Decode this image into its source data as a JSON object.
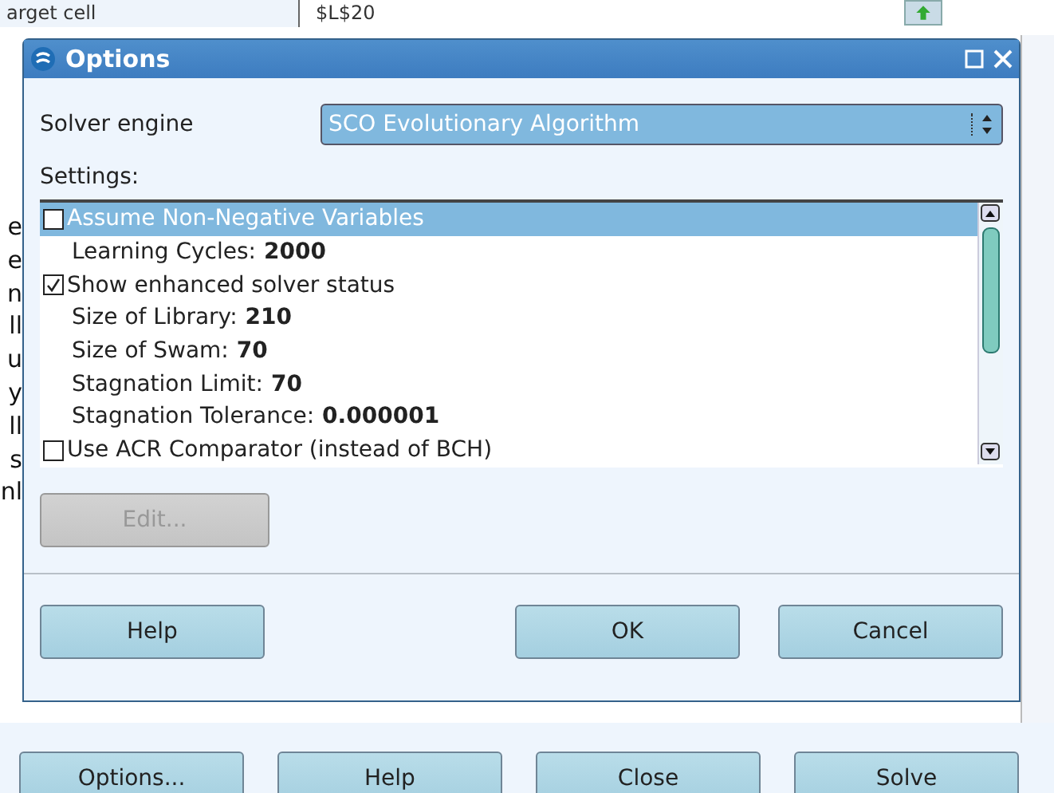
{
  "background": {
    "cell_label": "arget cell",
    "cell_value": "$L$20",
    "fragments": [
      "e",
      "e",
      "n",
      "ll",
      "u",
      "y",
      "ll",
      "s",
      "nl"
    ]
  },
  "dialog": {
    "title": "Options",
    "engine": {
      "label": "Solver engine",
      "value": "SCO Evolutionary Algorithm"
    },
    "settings_label": {
      "text": "Settings:"
    },
    "settings": [
      {
        "kind": "checkbox",
        "label": "Assume Non-Negative Variables",
        "checked": false,
        "selected": true
      },
      {
        "kind": "value",
        "label": "Learning Cycles:",
        "value": "2000",
        "selected": false
      },
      {
        "kind": "checkbox",
        "label": "Show enhanced solver status",
        "checked": true,
        "selected": false
      },
      {
        "kind": "value",
        "label": "Size of Library:",
        "value": "210",
        "selected": false
      },
      {
        "kind": "value",
        "label": "Size of Swam:",
        "value": "70",
        "selected": false
      },
      {
        "kind": "value",
        "label": "Stagnation Limit:",
        "value": "70",
        "selected": false
      },
      {
        "kind": "value",
        "label": "Stagnation Tolerance:",
        "value": "0.000001",
        "selected": false
      },
      {
        "kind": "checkbox",
        "label": "Use ACR Comparator (instead of BCH)",
        "checked": false,
        "selected": false
      }
    ],
    "edit_button": {
      "label": "Edit...",
      "disabled": true
    },
    "buttons": [
      {
        "label": "Help"
      },
      {
        "label": "OK"
      },
      {
        "label": "Cancel"
      }
    ]
  },
  "bottom_buttons": [
    {
      "label": "Options..."
    },
    {
      "label": "Help"
    },
    {
      "label": "Close"
    },
    {
      "label": "Solve"
    }
  ]
}
